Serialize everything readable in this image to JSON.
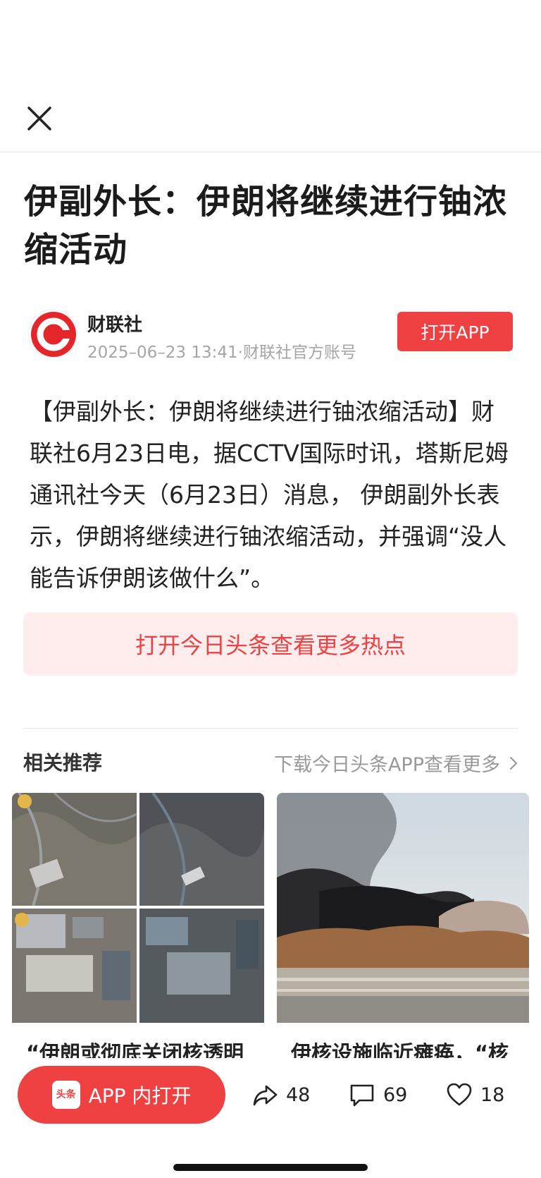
{
  "header": {
    "close_icon": "close-icon"
  },
  "article": {
    "title": "伊副外长：伊朗将继续进行铀浓缩活动",
    "author": {
      "name": "财联社",
      "meta": "2025–06–23 13:41·财联社官方账号",
      "avatar_icon": "cailianshe-logo"
    },
    "open_app_label": "打开APP",
    "body": "【伊副外长：伊朗将继续进行铀浓缩活动】财联社6月23日电，据CCTV国际时讯，塔斯尼姆通讯社今天（6月23日）消息，  伊朗副外长表示，伊朗将继续进行铀浓缩活动，并强调“没人能告诉伊朗该做什么”。"
  },
  "hot_banner": {
    "label": "打开今日头条查看更多热点"
  },
  "recommend": {
    "title": "相关推荐",
    "more_label": "下载今日头条APP查看更多",
    "cards": [
      {
        "text": "“伊朗或彻底关闭核透明",
        "image": "satellite-image"
      },
      {
        "text": "伊核设施临近瘫痪，“核",
        "image": "smoke-image"
      }
    ]
  },
  "bottom_bar": {
    "app_open_label": "APP 内打开",
    "logo_text": "头条",
    "share_count": "48",
    "comment_count": "69",
    "like_count": "18"
  },
  "colors": {
    "brand_red": "#f04142",
    "banner_bg": "#ffeded"
  }
}
